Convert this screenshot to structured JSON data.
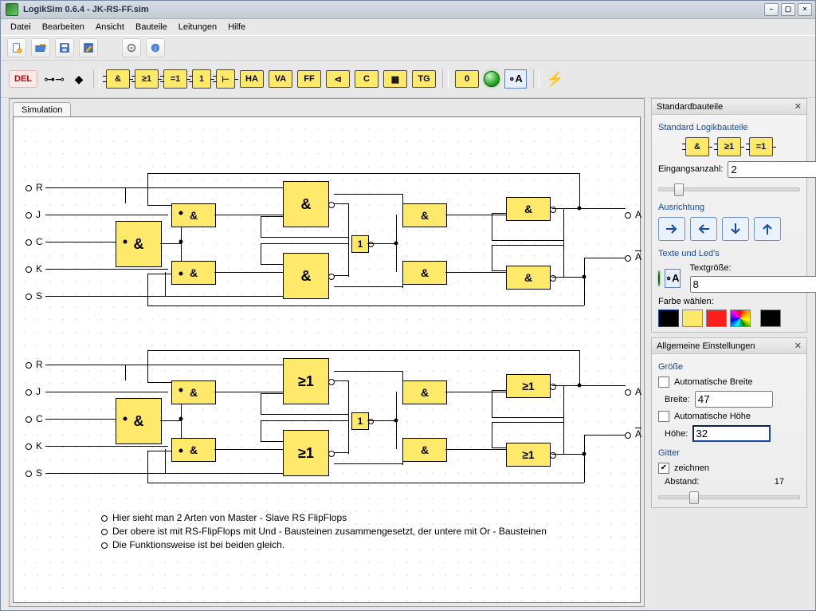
{
  "window": {
    "title": "LogikSim 0.6.4 - JK-RS-FF.sim"
  },
  "menu": [
    "Datei",
    "Bearbeiten",
    "Ansicht",
    "Bauteile",
    "Leitungen",
    "Hilfe"
  ],
  "toolbar1": {
    "icons": [
      "new",
      "open",
      "save",
      "edit",
      "gear",
      "info"
    ]
  },
  "toolstrip": {
    "delete": "DEL",
    "gates": {
      "and": "&",
      "or": "≥1",
      "xor": "=1",
      "buf": "1",
      "split": "⊢",
      "ha": "HA",
      "va": "VA",
      "ff": "FF",
      "mux": "⊲",
      "clk": "C",
      "dip": "▦",
      "tg": "TG",
      "zero": "0",
      "text": "∘A"
    }
  },
  "tab": "Simulation",
  "io_top": {
    "R": "R",
    "J": "J",
    "C": "C",
    "K": "K",
    "S": "S",
    "A": "A",
    "An": "_A"
  },
  "io_bot": {
    "R": "R",
    "J": "J",
    "C": "C",
    "K": "K",
    "S": "S",
    "A": "A",
    "An": "_A"
  },
  "gate_labels": {
    "and": "&",
    "or": "≥1",
    "buf": "1"
  },
  "comments": [
    "Hier sieht man 2 Arten von Master - Slave RS FlipFlops",
    "Der obere ist mit RS-FlipFlops mit Und - Bausteinen zusammengesetzt, der untere mit Or - Bausteinen",
    "Die Funktionsweise ist bei beiden gleich."
  ],
  "panel_std": {
    "title": "Standardbauteile",
    "group": "Standard Logikbauteile",
    "gates": [
      "&",
      "≥1",
      "=1"
    ],
    "inputs_label": "Eingangsanzahl:",
    "inputs_value": "2",
    "orient": "Ausrichtung",
    "texts": "Texte und Led's",
    "textsize_label": "Textgröße:",
    "textsize": "8",
    "colorpick": "Farbe wählen:",
    "colors": [
      "#000000",
      "#ffe96a",
      "#ff1e1e",
      "palette",
      "#000000"
    ]
  },
  "panel_gen": {
    "title": "Allgemeine Einstellungen",
    "size": "Größe",
    "auto_w": "Automatische Breite",
    "auto_w_checked": false,
    "w_label": "Breite:",
    "w": "47",
    "auto_h": "Automatische Höhe",
    "auto_h_checked": false,
    "h_label": "Höhe:",
    "h": "32",
    "grid": "Gitter",
    "draw": "zeichnen",
    "draw_checked": true,
    "dist_label": "Abstand:",
    "dist": "17"
  }
}
